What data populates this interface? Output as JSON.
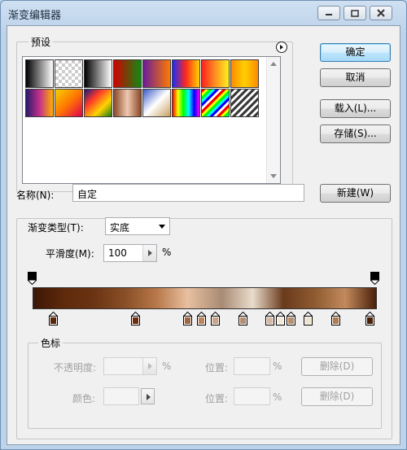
{
  "window": {
    "title": "渐变编辑器"
  },
  "presets": {
    "label": "预设",
    "swatches": [
      "linear-gradient(90deg,#000,#fff)",
      "repeating-conic-gradient(#ccc 0 25%, #fff 0 50%) 0 0/8px 8px, linear-gradient(90deg,#000,#fff)",
      "linear-gradient(90deg,#000,#fff)",
      "linear-gradient(90deg,#d10000,#118a11)",
      "linear-gradient(90deg,#6a1b9a,#ff7a00)",
      "linear-gradient(90deg,#1a2cff,#ff2a1a,#ffd400)",
      "linear-gradient(90deg,#ff2020,#ff9020,#fff020)",
      "linear-gradient(90deg,#ff8a00,#ffd000,#ff8a00)",
      "linear-gradient(90deg,#2a1a6b,#c22f8c,#ffb000)",
      "linear-gradient(135deg,#f5d000,#ff7700,#e0004e)",
      "linear-gradient(135deg,#1a1a7a,#ff3a2a,#ffd400,#1a7a1a)",
      "linear-gradient(90deg,#8a4a2a,#f0c8b0,#8a4a2a)",
      "linear-gradient(135deg,#3a5ac8,#ffffff,#c8a060)",
      "linear-gradient(90deg,#ff0000,#ffff00,#00ff00,#00ffff,#0000ff,#ff00ff)",
      "repeating-linear-gradient(135deg,#ff0000 0 3px,#ffff00 3px 6px,#00ff00 6px 9px,#00ffff 9px 12px,#0000ff 12px 15px,#fff 15px 18px)",
      "repeating-linear-gradient(135deg,#3a3a3a 0 3px,#ffffff 3px 6px)"
    ],
    "flyout_icon": "flyout-menu-icon"
  },
  "buttons": {
    "ok": "确定",
    "cancel": "取消",
    "load": "载入(L)...",
    "save": "存储(S)...",
    "new": "新建(W)",
    "delete": "删除(D)"
  },
  "name_field": {
    "label": "名称(N):",
    "value": "自定"
  },
  "gradient": {
    "type_label": "渐变类型(T):",
    "type_value": "实底",
    "smoothness_label": "平滑度(M):",
    "smoothness_value": "100",
    "smoothness_unit": "%",
    "bar_colors": [
      "#3d1606",
      "#5e2a0b",
      "#6b3413",
      "#8a5028",
      "#b8784a",
      "#e8c0a0",
      "#a88b74",
      "#eadccb",
      "#6a3a1c",
      "#8e5a30",
      "#c28a5c",
      "#4a200a"
    ],
    "color_stops": [
      {
        "pos": 0.06,
        "color": "#5a2408"
      },
      {
        "pos": 0.3,
        "color": "#6d2c0c"
      },
      {
        "pos": 0.45,
        "color": "#a06640"
      },
      {
        "pos": 0.49,
        "color": "#b9845e"
      },
      {
        "pos": 0.53,
        "color": "#cca48a"
      },
      {
        "pos": 0.61,
        "color": "#b58d6f"
      },
      {
        "pos": 0.69,
        "color": "#d8b8a0"
      },
      {
        "pos": 0.72,
        "color": "#f4e8d8"
      },
      {
        "pos": 0.75,
        "color": "#b98f6a"
      },
      {
        "pos": 0.8,
        "color": "#f1e2ce"
      },
      {
        "pos": 0.88,
        "color": "#b07b4e"
      },
      {
        "pos": 0.98,
        "color": "#4a2008"
      }
    ]
  },
  "stops_group": {
    "label": "色标",
    "opacity_label": "不透明度:",
    "opacity_unit": "%",
    "position_label": "位置:",
    "position_unit": "%",
    "color_label": "颜色:"
  },
  "colors": {
    "accent": "#3c7fb1"
  }
}
